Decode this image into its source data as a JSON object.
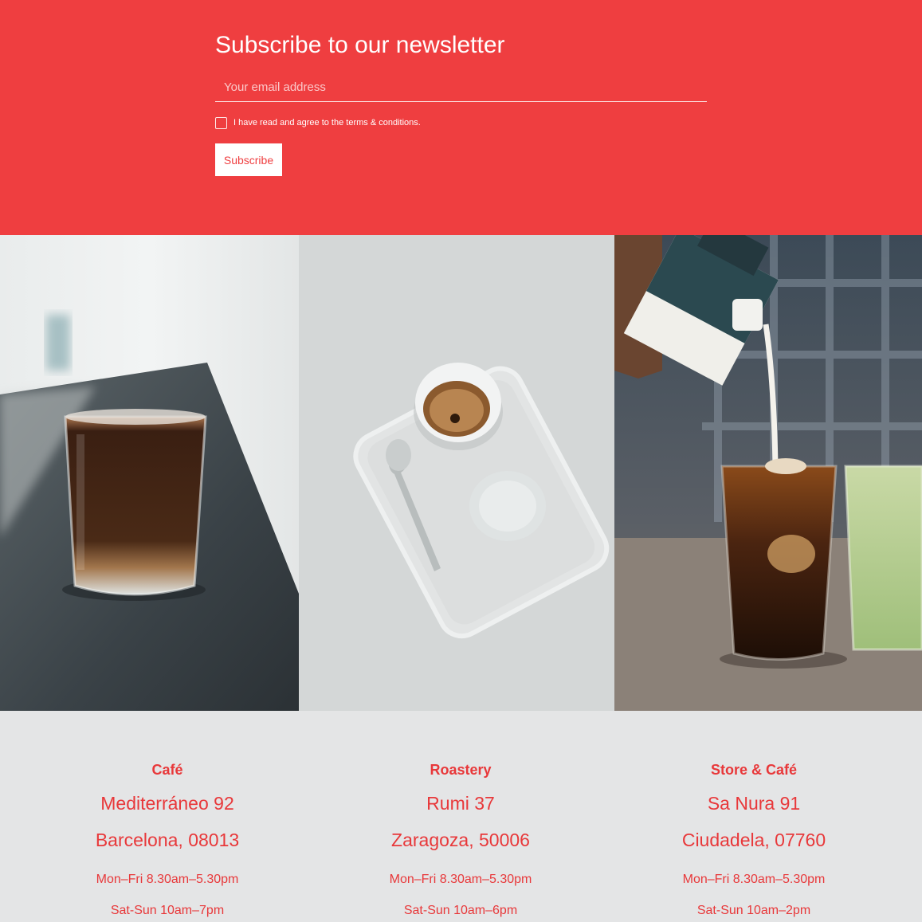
{
  "newsletter": {
    "title": "Subscribe to our newsletter",
    "email_placeholder": "Your email address",
    "terms_label": "I have read and agree to the terms & conditions.",
    "terms_checked": false,
    "subscribe_label": "Subscribe",
    "background_color": "#ef3e40"
  },
  "photos": [
    {
      "name": "iced-espresso-glass-photo"
    },
    {
      "name": "espresso-cup-tray-photo"
    },
    {
      "name": "milk-pouring-iced-coffee-photo"
    }
  ],
  "locations": [
    {
      "name": "Café",
      "street": "Mediterráneo 92",
      "city": "Barcelona, 08013",
      "weekday_hours": "Mon–Fri 8.30am–5.30pm",
      "weekend_hours": "Sat-Sun 10am–7pm"
    },
    {
      "name": "Roastery",
      "street": "Rumi 37",
      "city": "Zaragoza, 50006",
      "weekday_hours": "Mon–Fri 8.30am–5.30pm",
      "weekend_hours": "Sat-Sun 10am–6pm"
    },
    {
      "name": "Store & Café",
      "street": "Sa Nura 91",
      "city": "Ciudadela, 07760",
      "weekday_hours": "Mon–Fri 8.30am–5.30pm",
      "weekend_hours": "Sat-Sun 10am–2pm"
    }
  ],
  "accent_color": "#e8383a",
  "locations_background": "#e4e5e6"
}
